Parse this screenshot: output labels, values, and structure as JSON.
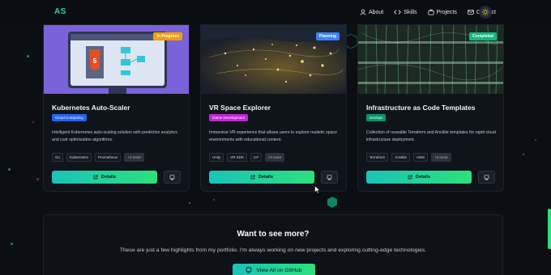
{
  "nav": {
    "logo": "AS",
    "items": [
      {
        "label": "About",
        "icon": "user-icon"
      },
      {
        "label": "Skills",
        "icon": "code-icon"
      },
      {
        "label": "Projects",
        "icon": "briefcase-icon"
      },
      {
        "label": "Contact",
        "icon": "mail-icon"
      }
    ],
    "theme_icon": "sun-icon"
  },
  "projects": [
    {
      "title": "Kubernetes Auto-Scaler",
      "status": "In Progress",
      "status_color": "#f59e0b",
      "category": "Cloud Computing",
      "category_color": "#2563eb",
      "description": "Intelligent Kubernetes auto-scaling solution with predictive analytics and cost optimization algorithms.",
      "tags": [
        "Go",
        "Kubernetes",
        "Prometheus"
      ],
      "more": "+2 more",
      "details_label": "Details",
      "image": "html5-diagram-illustration"
    },
    {
      "title": "VR Space Explorer",
      "status": "Planning",
      "status_color": "#3b82f6",
      "category": "Game Development",
      "category_color": "#c026d3",
      "description": "Immersive VR experience that allows users to explore realistic space environments with educational content.",
      "tags": [
        "Unity",
        "VR SDK",
        "C#"
      ],
      "more": "+2 more",
      "details_label": "Details",
      "image": "night-map-lights"
    },
    {
      "title": "Infrastructure as Code Templates",
      "status": "Completed",
      "status_color": "#10b981",
      "category": "DevOps",
      "category_color": "#059669",
      "description": "Collection of reusable Terraform and Ansible templates for rapid cloud infrastructure deployment.",
      "tags": [
        "Terraform",
        "Ansible",
        "AWS"
      ],
      "more": "+3 more",
      "details_label": "Details",
      "image": "server-rack-cables"
    }
  ],
  "cta": {
    "title": "Want to see more?",
    "text": "These are just a few highlights from my portfolio. I'm always working on new projects and exploring cutting-edge technologies.",
    "button": "View All on GitHub",
    "button_icon": "github-icon"
  },
  "colors": {
    "accent": "#2ee07c",
    "accent2": "#19c3b8",
    "background": "#0b0f14"
  }
}
